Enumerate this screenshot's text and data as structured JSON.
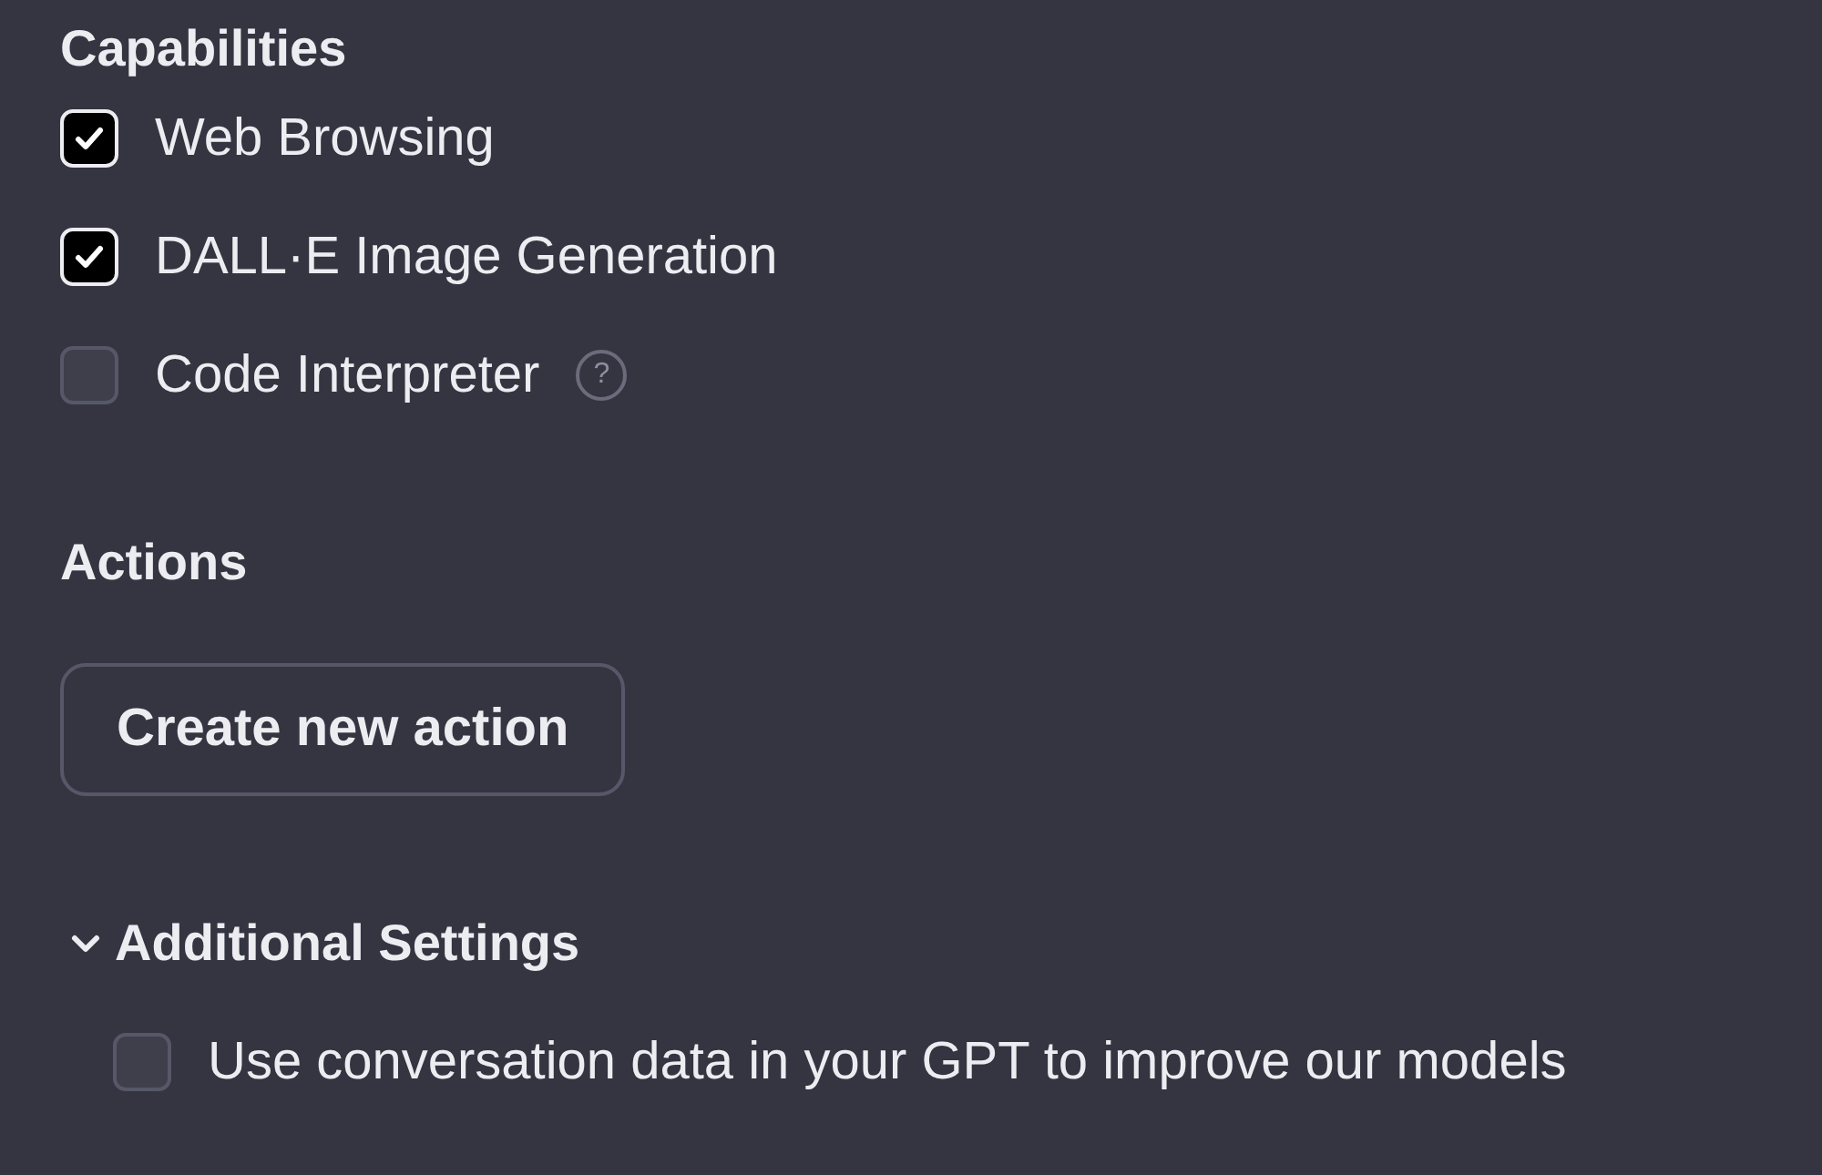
{
  "capabilities": {
    "heading": "Capabilities",
    "items": [
      {
        "label": "Web Browsing",
        "checked": true
      },
      {
        "label": "DALL·E Image Generation",
        "checked": true
      },
      {
        "label": "Code Interpreter",
        "checked": false,
        "help_icon": "?"
      }
    ]
  },
  "actions": {
    "heading": "Actions",
    "button": "Create new action"
  },
  "additional_settings": {
    "heading": "Additional Settings",
    "expanded": true,
    "options": [
      {
        "label": "Use conversation data in your GPT to improve our models",
        "checked": false
      }
    ]
  }
}
